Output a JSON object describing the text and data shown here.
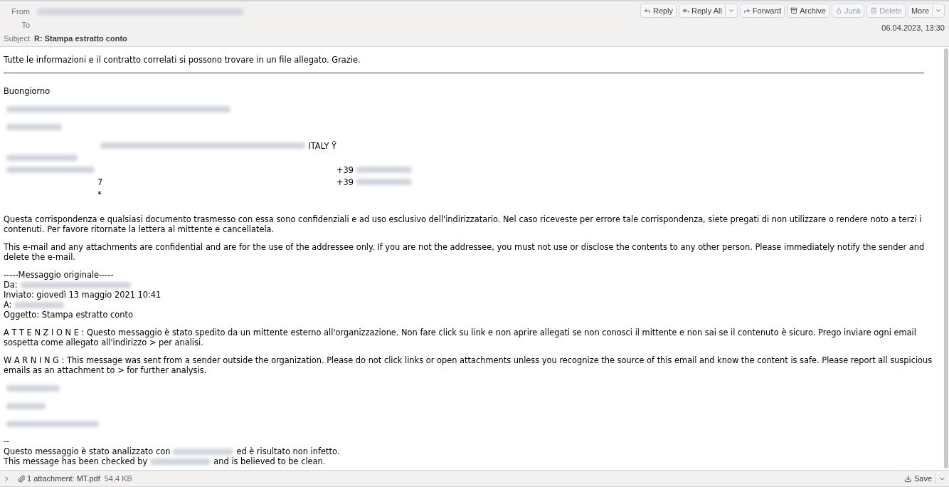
{
  "header": {
    "fields": [
      {
        "label": "From",
        "value": [
          {
            "kind": "redacted"
          }
        ]
      },
      {
        "label": "To"
      },
      {
        "label": "Subject",
        "value": [
          {
            "kind": "text",
            "text": "R: Stampa estratto conto"
          }
        ]
      }
    ],
    "buttons": [
      {
        "label": "Reply",
        "disabled": false,
        "menu": false
      },
      {
        "label": "Reply All",
        "disabled": false,
        "menu": true
      },
      {
        "label": "Forward",
        "disabled": false,
        "menu": false
      },
      {
        "label": "Archive",
        "disabled": false,
        "menu": false
      },
      {
        "label": "Junk",
        "disabled": true,
        "menu": false
      },
      {
        "label": "Delete",
        "disabled": true,
        "menu": false
      },
      {
        "label": "More",
        "disabled": false,
        "menu": true
      }
    ],
    "date": "06.04.2023, 13:30"
  },
  "body": [
    {
      "kind": "para",
      "lines": [
        [
          {
            "kind": "text",
            "text": "Tutte le informazioni e il contratto correlati si possono trovare in un file allegato. Grazie."
          }
        ]
      ]
    },
    {
      "kind": "rule"
    },
    {
      "kind": "para",
      "lines": [
        [
          {
            "kind": "text",
            "text": "Buongiorno"
          }
        ]
      ]
    },
    {
      "kind": "para",
      "lines": [
        [
          {
            "kind": "redacted"
          }
        ]
      ]
    },
    {
      "kind": "para",
      "lines": [
        [
          {
            "kind": "redacted"
          }
        ]
      ]
    },
    {
      "kind": "signature",
      "rows": [
        [
          [],
          [
            {
              "kind": "redacted"
            },
            {
              "kind": "text",
              "text": "ITALY Ÿ"
            }
          ],
          []
        ],
        [
          [
            {
              "kind": "redacted"
            }
          ],
          [],
          []
        ],
        [
          [
            {
              "kind": "redacted"
            }
          ],
          [],
          [
            {
              "kind": "text",
              "text": "+39"
            },
            {
              "kind": "redacted"
            }
          ]
        ],
        [
          [],
          [
            {
              "kind": "text",
              "text": "7"
            }
          ],
          [
            {
              "kind": "text",
              "text": "+39"
            },
            {
              "kind": "redacted"
            }
          ]
        ],
        [
          [],
          [
            {
              "kind": "text",
              "text": "*"
            }
          ],
          []
        ]
      ]
    },
    {
      "kind": "para",
      "lines": [
        [
          {
            "kind": "text",
            "text": "Questa corrispondenza e qualsiasi documento trasmesso con essa sono confidenziali e ad uso esclusivo dell'indirizzatario. Nel caso riceveste per errore tale corrispondenza, siete pregati di non utilizzare o rendere noto a terzi i contenuti. Per favore ritornate la lettera al mittente e cancellatela."
          }
        ]
      ]
    },
    {
      "kind": "para",
      "lines": [
        [
          {
            "kind": "text",
            "text": "This e-mail and any attachments are confidential and are for the use of the addressee only. If you are not the addressee, you must not use or disclose the contents to any other person. Please immediately notify the sender and delete the e-mail."
          }
        ]
      ]
    },
    {
      "kind": "para",
      "lines": [
        [
          {
            "kind": "text",
            "text": "-----Messaggio originale-----"
          }
        ],
        [
          {
            "kind": "text",
            "text": "Da:"
          },
          {
            "kind": "redacted"
          }
        ],
        [
          {
            "kind": "text",
            "text": "Inviato: giovedì 13 maggio 2021 10:41"
          }
        ],
        [
          {
            "kind": "text",
            "text": "A:"
          },
          {
            "kind": "redacted"
          }
        ],
        [
          {
            "kind": "text",
            "text": "Oggetto: Stampa estratto conto"
          }
        ]
      ]
    },
    {
      "kind": "para",
      "lines": [
        [
          {
            "kind": "text",
            "text": "A T T E N Z I O N E : Questo messaggio è stato spedito da un mittente esterno all'organizzazione. Non fare click su link e non aprire allegati se non conosci il mittente e non sai se il contenuto è sicuro. Prego inviare ogni email sospetta come allegato all'indirizzo > per analisi."
          }
        ]
      ]
    },
    {
      "kind": "para",
      "lines": [
        [
          {
            "kind": "text",
            "text": "W A R N I N G : This message was sent from a sender outside the organization. Please do not click links or open attachments unless you recognize the source of this email and know the content is safe. Please report all suspicious emails as an attachment to > for further analysis."
          }
        ]
      ]
    },
    {
      "kind": "para",
      "lines": [
        [
          {
            "kind": "redacted"
          }
        ]
      ]
    },
    {
      "kind": "para",
      "lines": [
        [
          {
            "kind": "redacted"
          }
        ]
      ]
    },
    {
      "kind": "para",
      "lines": [
        [
          {
            "kind": "redacted"
          }
        ]
      ]
    },
    {
      "kind": "para",
      "lines": [
        [
          {
            "kind": "text",
            "text": "--"
          }
        ],
        [
          {
            "kind": "text",
            "text": "Questo messaggio è stato analizzato con"
          },
          {
            "kind": "redacted"
          },
          {
            "kind": "text",
            "text": "ed è risultato non infetto."
          }
        ],
        [
          {
            "kind": "text",
            "text": "This message has been checked by"
          },
          {
            "kind": "redacted"
          },
          {
            "kind": "text",
            "text": "and is believed to be clean."
          }
        ]
      ]
    }
  ],
  "attachments": {
    "expanded": false,
    "summary": "1 attachment: MT.pdf",
    "size": "54,4 KB",
    "save": "Save"
  }
}
